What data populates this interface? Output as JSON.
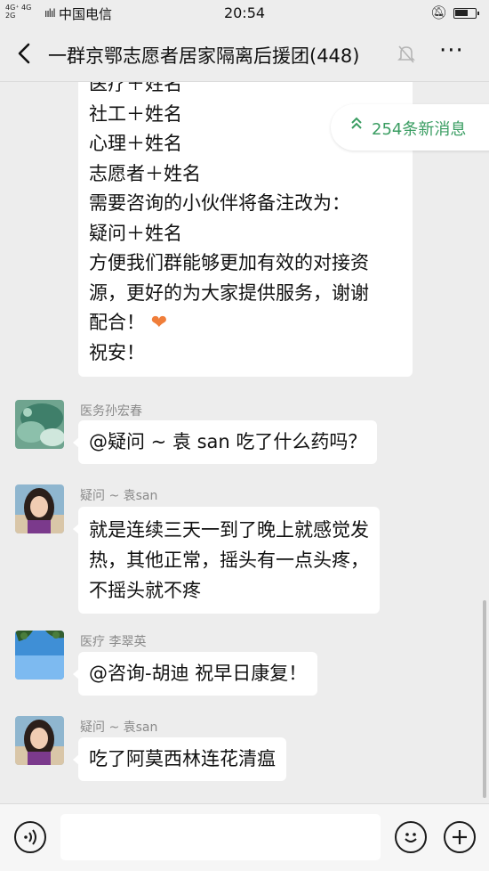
{
  "status_bar": {
    "network": "4G⁺ 4G 2G",
    "signal": "ıılıl",
    "carrier": "中国电信",
    "time": "20:54"
  },
  "header": {
    "back_icon": "chevron-left-icon",
    "title": "一群京鄂志愿者居家隔离后援团(448)",
    "mute_icon": "bell-muted-icon",
    "more_label": "···"
  },
  "new_messages": {
    "label": "254条新消息",
    "chevron": "double-chevron-up-icon",
    "accent_color": "#3a9d62"
  },
  "messages": [
    {
      "sender": "",
      "lines": [
        "医疗＋姓名",
        "社工＋姓名",
        "心理＋姓名",
        "志愿者＋姓名",
        "需要咨询的小伙伴将备注改为：",
        "疑问＋姓名",
        "方便我们群能够更加有效的对接资",
        "源，更好的为大家提供服务，谢谢",
        "配合！",
        "祝安！"
      ],
      "heart": "❤"
    },
    {
      "sender": "医务孙宏春",
      "text": "@疑问 ~ 袁 san  吃了什么药吗？",
      "avatar": "lotus-leaf"
    },
    {
      "sender": "疑问 ~ 袁san",
      "lines": [
        "就是连续三天一到了晚上就感觉发",
        "热，其他正常，摇头有一点头疼，",
        "不摇头就不疼"
      ],
      "avatar": "girl-portrait"
    },
    {
      "sender": "医疗  李翠英",
      "text": "@咨询-胡迪  祝早日康复！",
      "avatar": "sky-tree"
    },
    {
      "sender": "疑问 ~ 袁san",
      "text": "吃了阿莫西林连花清瘟",
      "avatar": "girl-portrait"
    }
  ],
  "input_bar": {
    "voice_icon": "voice-icon",
    "input_value": "",
    "emoji_icon": "emoji-icon",
    "plus_icon": "plus-icon"
  }
}
